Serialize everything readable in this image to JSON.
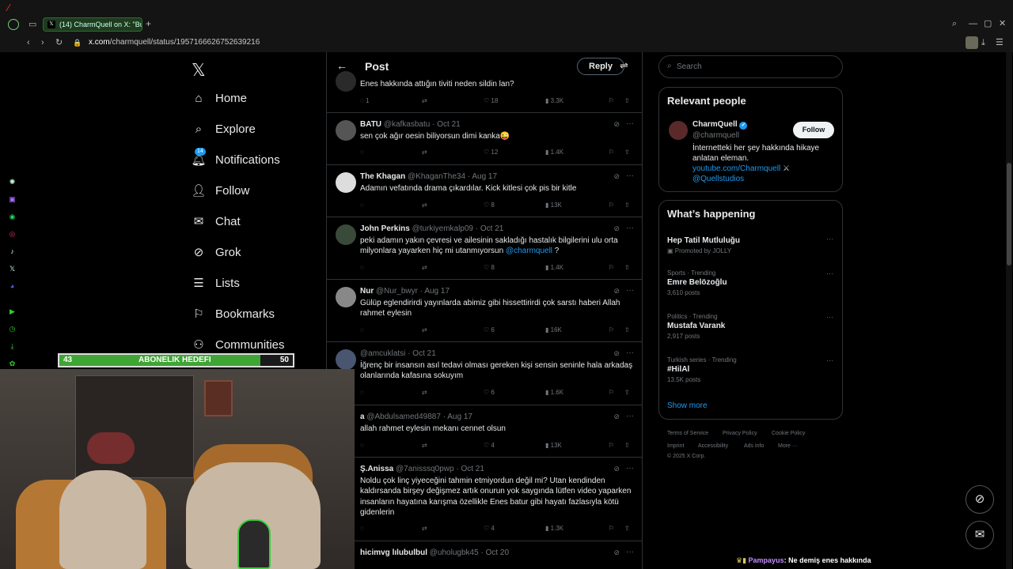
{
  "browser": {
    "tab_title": "(14) CharmQuell on X: \"Bu",
    "url_prefix": "x.com",
    "url_path": "/charmquell/status/1957166626752639216"
  },
  "nav": {
    "home": "Home",
    "explore": "Explore",
    "notifications": "Notifications",
    "notifications_badge": "14",
    "follow": "Follow",
    "chat": "Chat",
    "grok": "Grok",
    "lists": "Lists",
    "bookmarks": "Bookmarks",
    "communities": "Communities"
  },
  "header": {
    "title": "Post",
    "reply": "Reply"
  },
  "tweets": [
    {
      "text": "Enes hakkında attığın tiviti neden sildin lan?",
      "replies": "1",
      "likes": "18",
      "views": "3.3K"
    },
    {
      "name": "BATU",
      "handle": "@kafkasbatu",
      "date": "Oct 21",
      "text": "sen çok ağır oesin biliyorsun dimi kanka😜",
      "replies": "",
      "likes": "12",
      "views": "1.4K"
    },
    {
      "name": "The Khagan",
      "handle": "@KhaganThe34",
      "date": "Aug 17",
      "text": "Adamın vefatında drama çıkardılar. Kick kitlesi çok pis bir kitle",
      "likes": "8",
      "views": "13K"
    },
    {
      "name": "John Perkins",
      "handle": "@turkiyemkalp09",
      "date": "Oct 21",
      "text": "peki adamın yakın çevresi ve ailesinin sakladığı hastalık bilgilerini ulu orta milyonlara yayarken hiç mi utanmıyorsun",
      "mention": "@charmquell",
      "text_end": " ?",
      "likes": "8",
      "views": "1.4K"
    },
    {
      "name": "Nur",
      "handle": "@Nur_bwyr",
      "date": "Aug 17",
      "text": "Gülüp eglendirirdi yayınlarda abimiz gibi hissettirirdi çok sarstı haberi Allah rahmet eylesin",
      "likes": "6",
      "views": "16K"
    },
    {
      "name": "",
      "handle": "@amcuklatsi",
      "date": "Oct 21",
      "text": "İğrenç bir insansın asıl tedavi olması gereken kişi sensin seninle hala arkadaş olanlarında kafasına sokuyım",
      "likes": "6",
      "views": "1.6K"
    },
    {
      "name": "a",
      "handle": "@Abdulsamed49887",
      "date": "Aug 17",
      "text": "allah rahmet eylesin mekanı cennet olsun",
      "likes": "4",
      "views": "13K"
    },
    {
      "name": "Ş.Anissa",
      "handle": "@7anisssq0pwp",
      "date": "Oct 21",
      "text": "Noldu çok linç yiyeceğini tahmin etmiyordun değil mi? Utan kendinden kaldırsanda birşey değişmez artık onurun yok saygında lütfen video yaparken insanların hayatına karışma özellikle Enes batur gibi hayatı fazlasıyla kötü gidenlerin",
      "likes": "4",
      "views": "1.3K"
    },
    {
      "name": "hicimvg lılubulbul",
      "handle": "@uholugbk45",
      "date": "Oct 20"
    }
  ],
  "right": {
    "search_placeholder": "Search",
    "relevant_title": "Relevant people",
    "person_name": "CharmQuell",
    "person_handle": "@charmquell",
    "follow": "Follow",
    "bio": "İnternetteki her şey hakkında hikaye anlatan eleman.",
    "bio_link1": "youtube.com/Charmquell",
    "bio_link2": "@Quellstudios",
    "happening_title": "What’s happening",
    "trends": [
      {
        "category": "",
        "name": "Hep Tatil Mutluluğu",
        "count": "Promoted by JOLLY"
      },
      {
        "category": "Sports · Trending",
        "name": "Emre Belözoğlu",
        "count": "3,610 posts"
      },
      {
        "category": "Politics · Trending",
        "name": "Mustafa Varank",
        "count": "2,917 posts"
      },
      {
        "category": "Turkish series · Trending",
        "name": "#HilAl",
        "count": "13.5K posts"
      }
    ],
    "show_more": "Show more",
    "footer": [
      "Terms of Service",
      "Privacy Policy",
      "Cookie Policy",
      "Imprint",
      "Accessibility",
      "Ads info",
      "More ···",
      "© 2025 X Corp."
    ]
  },
  "overlay": {
    "goal_current": "43",
    "goal_label": "ABONELIK HEDEFI",
    "goal_target": "50",
    "goal_fraction": 0.86,
    "chat_user": "Pampayus",
    "chat_text": ": Ne demiş enes hakkında"
  },
  "colors": {
    "accent": "#1d9bf0",
    "goal_green": "#3fa535",
    "bg": "#000000"
  }
}
